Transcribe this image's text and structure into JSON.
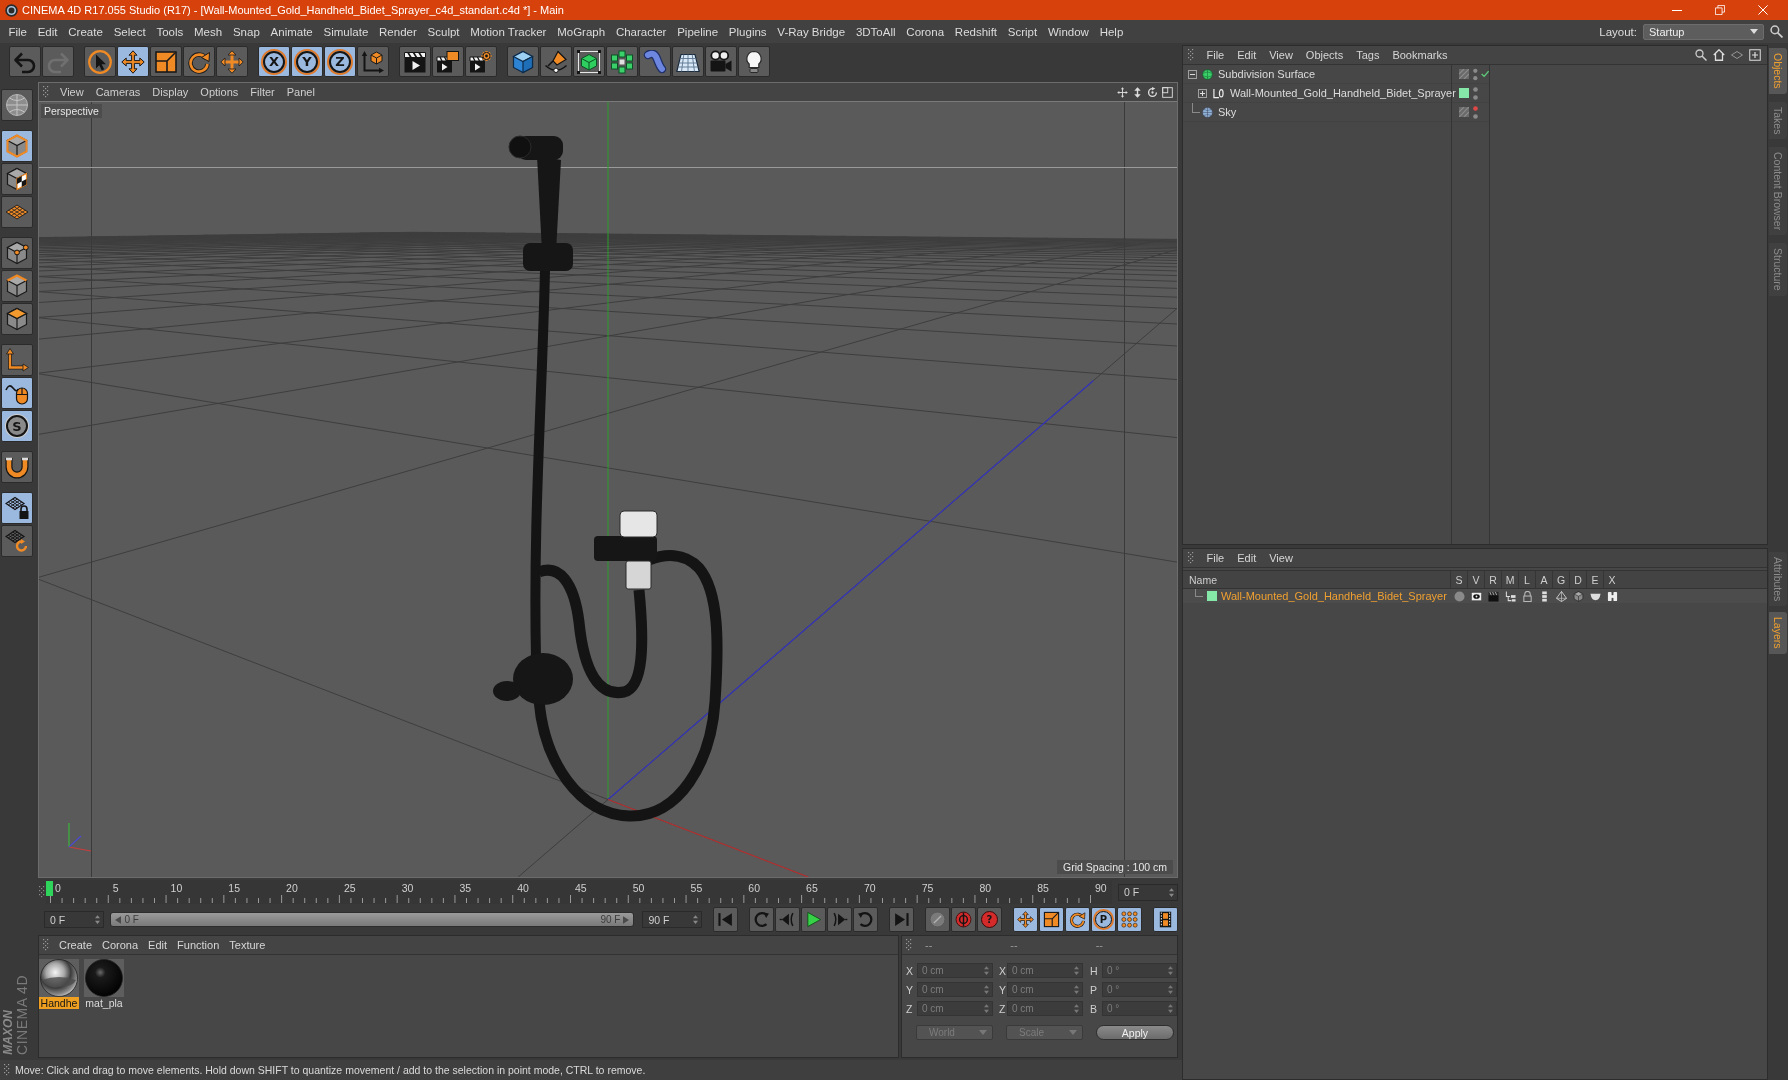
{
  "window": {
    "title": "CINEMA 4D R17.055 Studio (R17) - [Wall-Mounted_Gold_Handheld_Bidet_Sprayer_c4d_standart.c4d *] - Main"
  },
  "menu_bar": {
    "items": [
      "File",
      "Edit",
      "Create",
      "Select",
      "Tools",
      "Mesh",
      "Snap",
      "Animate",
      "Simulate",
      "Render",
      "Sculpt",
      "Motion Tracker",
      "MoGraph",
      "Character",
      "Pipeline",
      "Plugins",
      "V-Ray Bridge",
      "3DToAll",
      "Corona",
      "Redshift",
      "Script",
      "Window",
      "Help"
    ],
    "layout_label": "Layout:",
    "layout_value": "Startup"
  },
  "toolbar": {
    "groups": [
      [
        {
          "kind": "undo",
          "active": false,
          "disabled": false
        },
        {
          "kind": "redo",
          "active": false,
          "disabled": true
        }
      ],
      [
        {
          "kind": "select",
          "active": false
        },
        {
          "kind": "move",
          "active": true
        },
        {
          "kind": "scale",
          "active": false
        },
        {
          "kind": "rotate",
          "active": false
        },
        {
          "kind": "last-tool",
          "active": false
        }
      ],
      [
        {
          "kind": "axis-lock",
          "label": "X",
          "active": true
        },
        {
          "kind": "axis-lock",
          "label": "Y",
          "active": true
        },
        {
          "kind": "axis-lock",
          "label": "Z",
          "active": true
        },
        {
          "kind": "coord-system",
          "active": false
        }
      ],
      [
        {
          "kind": "render-view",
          "active": false
        },
        {
          "kind": "render-picture",
          "active": false
        },
        {
          "kind": "render-settings",
          "active": false
        }
      ],
      [
        {
          "kind": "cube",
          "active": false
        },
        {
          "kind": "pen",
          "active": false
        },
        {
          "kind": "subdivision",
          "active": false
        },
        {
          "kind": "cloner",
          "active": false
        },
        {
          "kind": "deformer",
          "active": false
        },
        {
          "kind": "floor",
          "active": false
        },
        {
          "kind": "camera",
          "active": false
        },
        {
          "kind": "light",
          "active": false
        }
      ]
    ]
  },
  "tool_palette": {
    "groups": [
      [
        {
          "kind": "make-editable",
          "active": false
        }
      ],
      [
        {
          "kind": "model",
          "active": true
        },
        {
          "kind": "texture",
          "active": false
        },
        {
          "kind": "workplane",
          "active": false
        }
      ],
      [
        {
          "kind": "points",
          "active": false
        },
        {
          "kind": "edges",
          "active": false
        },
        {
          "kind": "polygons",
          "active": false
        }
      ],
      [
        {
          "kind": "axis",
          "active": false
        },
        {
          "kind": "tweak",
          "active": true
        },
        {
          "kind": "solo",
          "label": "S",
          "active": true
        }
      ],
      [
        {
          "kind": "snap",
          "active": false
        }
      ],
      [
        {
          "kind": "grid-lock",
          "active": true
        },
        {
          "kind": "grid-refresh",
          "active": false
        }
      ]
    ]
  },
  "brand": {
    "lines": [
      "MAXON",
      "CINEMA 4D"
    ]
  },
  "viewport": {
    "menu": [
      "View",
      "Cameras",
      "Display",
      "Options",
      "Filter",
      "Panel"
    ],
    "camera": "Perspective",
    "grid_spacing": "Grid Spacing : 100 cm"
  },
  "timeline": {
    "labels": [
      "0",
      "5",
      "10",
      "15",
      "20",
      "25",
      "30",
      "35",
      "40",
      "45",
      "50",
      "55",
      "60",
      "65",
      "70",
      "75",
      "80",
      "85",
      "90"
    ],
    "playhead": {
      "level": 0
    },
    "current_frame": "0 F"
  },
  "transport": {
    "start": "0 F",
    "range": {
      "start": "0 F",
      "end": "90 F"
    },
    "end": "90 F",
    "groups": [
      [
        {
          "kind": "go-start",
          "active": false
        }
      ],
      [
        {
          "kind": "prev-key",
          "active": false
        },
        {
          "kind": "prev-frame",
          "active": false
        },
        {
          "kind": "play",
          "active": false
        },
        {
          "kind": "next-frame",
          "active": false
        },
        {
          "kind": "next-key",
          "active": false
        }
      ],
      [
        {
          "kind": "go-end",
          "active": false
        }
      ],
      [
        {
          "kind": "record",
          "active": false
        },
        {
          "kind": "autokey",
          "active": false
        },
        {
          "kind": "key-selection",
          "label": "?",
          "active": false
        }
      ],
      [
        {
          "kind": "move",
          "active": true
        },
        {
          "kind": "scale",
          "active": true
        },
        {
          "kind": "rotate",
          "active": true
        },
        {
          "kind": "param",
          "label": "P",
          "active": true
        },
        {
          "kind": "point-level",
          "active": true
        }
      ],
      [
        {
          "kind": "timeline",
          "active": true
        }
      ]
    ]
  },
  "material_manager": {
    "menu": [
      "Create",
      "Corona",
      "Edit",
      "Function",
      "Texture"
    ],
    "materials": [
      {
        "name": "Handhe",
        "kind": "chrome",
        "selected": true
      },
      {
        "name": "mat_pla",
        "kind": "black",
        "selected": false
      }
    ]
  },
  "coordinates": {
    "headers": [
      "--",
      "--",
      "--"
    ],
    "rows": [
      {
        "labels": [
          "X",
          "X",
          "H"
        ],
        "values": [
          "0 cm",
          "0 cm",
          "0 °"
        ]
      },
      {
        "labels": [
          "Y",
          "Y",
          "P"
        ],
        "values": [
          "0 cm",
          "0 cm",
          "0 °"
        ]
      },
      {
        "labels": [
          "Z",
          "Z",
          "B"
        ],
        "values": [
          "0 cm",
          "0 cm",
          "0 °"
        ]
      }
    ],
    "dropdowns": [
      "World",
      "Scale"
    ],
    "apply": "Apply",
    "disabled": true
  },
  "status_bar": {
    "text": "Move: Click and drag to move elements. Hold down SHIFT to quantize movement / add to the selection in point mode, CTRL to remove."
  },
  "object_manager": {
    "menu": [
      "File",
      "Edit",
      "View",
      "Objects",
      "Tags",
      "Bookmarks"
    ],
    "objects": [
      {
        "name": "Subdivision Surface",
        "kind": "subdivision",
        "expanded": true,
        "hidden_in_editor": false,
        "checked": true,
        "children": [
          {
            "name": "Wall-Mounted_Gold_Handheld_Bidet_Sprayer",
            "kind": "null",
            "expanded": false,
            "hidden_in_editor": false,
            "checked": false,
            "color": "#86e8a8"
          }
        ]
      },
      {
        "name": "Sky",
        "kind": "sky",
        "hidden_in_editor": true,
        "checked": false
      }
    ],
    "tabs": [
      {
        "label": "Objects",
        "selected": true
      },
      {
        "label": "Takes",
        "selected": false
      },
      {
        "label": "Content Browser",
        "selected": false
      },
      {
        "label": "Structure",
        "selected": false
      }
    ]
  },
  "layer_manager": {
    "menu": [
      "File",
      "Edit",
      "View"
    ],
    "columns": [
      "Name",
      "S",
      "V",
      "R",
      "M",
      "L",
      "A",
      "G",
      "D",
      "E",
      "X"
    ],
    "layers": [
      {
        "name": "Wall-Mounted_Gold_Handheld_Bidet_Sprayer",
        "color": "#86e8a8",
        "selected": true
      }
    ],
    "tabs": [
      {
        "label": "Attributes",
        "selected": false
      },
      {
        "label": "Layers",
        "selected": true
      }
    ]
  }
}
